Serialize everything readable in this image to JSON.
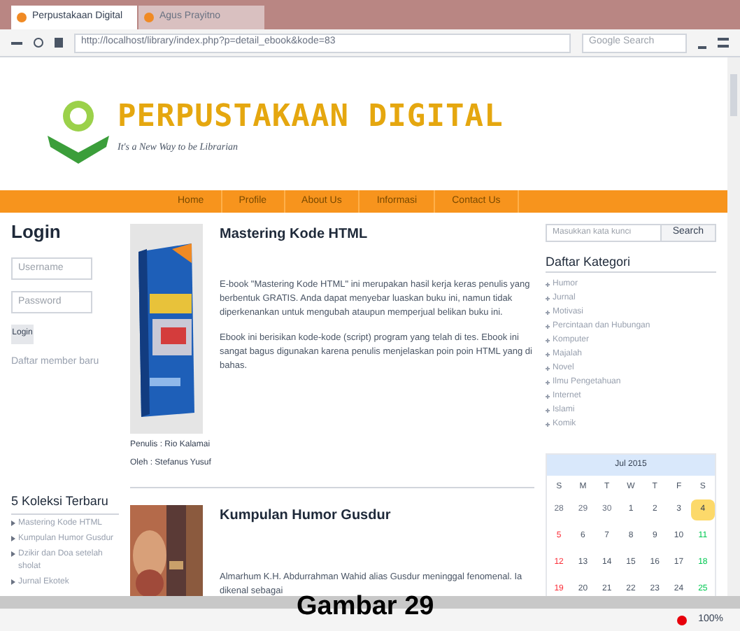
{
  "browser": {
    "tabs": [
      {
        "label": "Perpustakaan Digital",
        "selected": true
      },
      {
        "label": "Agus Prayitno",
        "selected": false
      }
    ],
    "url": "http://localhost/library/index.php?p=detail_ebook&kode=83",
    "search": {
      "placeholder": "Google Search"
    }
  },
  "site": {
    "title": "PERPUSTAKAAN DIGITAL",
    "tagline": "It's a New Way to be Librarian",
    "nav": [
      {
        "label": "Home"
      },
      {
        "label": "Profile"
      },
      {
        "label": "About Us"
      },
      {
        "label": "Informasi"
      },
      {
        "label": "Contact Us"
      }
    ]
  },
  "login": {
    "title": "Login",
    "username": {
      "placeholder": "Username"
    },
    "password": {
      "placeholder": "Password"
    },
    "button": "Login",
    "register": "Daftar member baru"
  },
  "latest": {
    "title": "5 Koleksi Terbaru",
    "items": [
      "Mastering Kode HTML",
      "Kumpulan Humor Gusdur",
      "Dzikir dan Doa setelah sholat",
      "Jurnal Ekotek"
    ]
  },
  "books": [
    {
      "title": "Mastering Kode HTML",
      "paragraphs": [
        "E-book \"Mastering Kode HTML\" ini merupakan hasil kerja keras penulis yang berbentuk GRATIS. Anda dapat menyebar luaskan buku ini, namun tidak diperkenankan untuk mengubah ataupun memperjual belikan buku ini.",
        "Ebook ini berisikan kode-kode (script) program yang telah di tes. Ebook ini sangat bagus digunakan karena penulis menjelaskan poin poin HTML yang di bahas."
      ],
      "meta": [
        "Penulis : Rio Kalamai",
        "Oleh : Stefanus Yusuf"
      ]
    },
    {
      "title": "Kumpulan Humor Gusdur",
      "paragraphs": [
        "Almarhum K.H. Abdurrahman Wahid alias Gusdur meninggal fenomenal. Ia dikenal sebagai"
      ]
    }
  ],
  "search": {
    "placeholder": "Masukkan kata kunci",
    "button": "Search"
  },
  "categories": {
    "title": "Daftar Kategori",
    "items": [
      "Humor",
      "Jurnal",
      "Motivasi",
      "Percintaan dan Hubungan",
      "Komputer",
      "Majalah",
      "Novel",
      "Ilmu Pengetahuan",
      "Internet",
      "Islami",
      "Komik"
    ]
  },
  "calendar": {
    "month": "Jul 2015",
    "days": [
      "S",
      "M",
      "T",
      "W",
      "T",
      "F",
      "S"
    ],
    "weeks": [
      [
        {
          "d": "28",
          "kind": "other"
        },
        {
          "d": "29",
          "kind": "other"
        },
        {
          "d": "30",
          "kind": "other"
        },
        {
          "d": "1",
          "kind": "day"
        },
        {
          "d": "2",
          "kind": "day"
        },
        {
          "d": "3",
          "kind": "day"
        },
        {
          "d": "4",
          "kind": "today"
        }
      ],
      [
        {
          "d": "5",
          "kind": "sunday"
        },
        {
          "d": "6",
          "kind": "day"
        },
        {
          "d": "7",
          "kind": "day"
        },
        {
          "d": "8",
          "kind": "day"
        },
        {
          "d": "9",
          "kind": "day"
        },
        {
          "d": "10",
          "kind": "day"
        },
        {
          "d": "11",
          "kind": "saturday"
        }
      ],
      [
        {
          "d": "12",
          "kind": "sunday"
        },
        {
          "d": "13",
          "kind": "day"
        },
        {
          "d": "14",
          "kind": "day"
        },
        {
          "d": "15",
          "kind": "day"
        },
        {
          "d": "16",
          "kind": "day"
        },
        {
          "d": "17",
          "kind": "day"
        },
        {
          "d": "18",
          "kind": "saturday"
        }
      ],
      [
        {
          "d": "19",
          "kind": "sunday"
        },
        {
          "d": "20",
          "kind": "day"
        },
        {
          "d": "21",
          "kind": "day"
        },
        {
          "d": "22",
          "kind": "day"
        },
        {
          "d": "23",
          "kind": "day"
        },
        {
          "d": "24",
          "kind": "day"
        },
        {
          "d": "25",
          "kind": "saturday"
        }
      ]
    ]
  },
  "status": {
    "zoom": "100%"
  },
  "caption": "Gambar 29"
}
